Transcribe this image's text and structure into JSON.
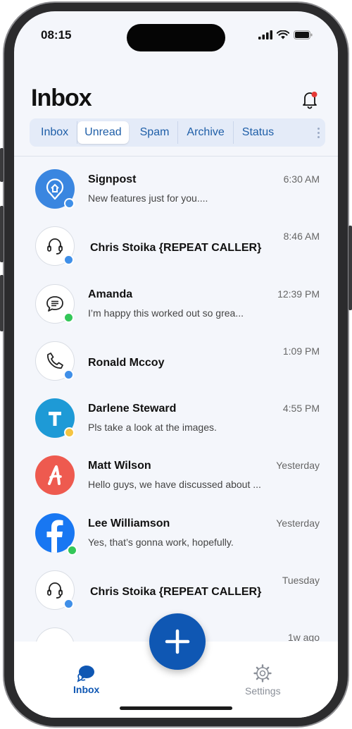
{
  "status_bar": {
    "time": "08:15"
  },
  "header": {
    "title": "Inbox"
  },
  "tabs": [
    {
      "label": "Inbox"
    },
    {
      "label": "Unread"
    },
    {
      "label": "Spam"
    },
    {
      "label": "Archive"
    },
    {
      "label": "Status"
    }
  ],
  "colors": {
    "accent": "#0f57b3",
    "tab_bg": "#e4ebf8",
    "online": "#34c759",
    "blue_dot": "#3f8fe8",
    "yellow_dot": "#f5c542",
    "bell_badge": "#e53935"
  },
  "conversations": [
    {
      "name": "Signpost",
      "preview": "New features just for you....",
      "time": "6:30 AM",
      "icon": "signpost-logo",
      "status": "blue"
    },
    {
      "name": "Chris Stoika {REPEAT CALLER}",
      "preview": "",
      "time": "8:46 AM",
      "icon": "headset-icon",
      "status": "blue"
    },
    {
      "name": "Amanda",
      "preview": "I’m happy this worked out so grea...",
      "time": "12:39 PM",
      "icon": "chat-bubble-icon",
      "status": "green"
    },
    {
      "name": "Ronald Mccoy",
      "preview": "",
      "time": "1:09 PM",
      "icon": "phone-icon",
      "status": "blue"
    },
    {
      "name": "Darlene Steward",
      "preview": "Pls take a look at the images.",
      "time": "4:55 PM",
      "icon": "letter-t-logo",
      "status": "yellow"
    },
    {
      "name": "Matt Wilson",
      "preview": "Hello guys, we have discussed about ...",
      "time": "Yesterday",
      "icon": "letter-a-logo",
      "status": "none"
    },
    {
      "name": "Lee Williamson",
      "preview": "Yes, that’s gonna work, hopefully.",
      "time": "Yesterday",
      "icon": "facebook-logo",
      "status": "green"
    },
    {
      "name": "Chris Stoika {REPEAT CALLER}",
      "preview": "",
      "time": "Tuesday",
      "icon": "headset-icon",
      "status": "blue"
    },
    {
      "name": "",
      "preview": "",
      "time": "1w ago",
      "icon": "avatar-partial",
      "status": "none"
    }
  ],
  "bottom_nav": {
    "inbox_label": "Inbox",
    "settings_label": "Settings"
  }
}
